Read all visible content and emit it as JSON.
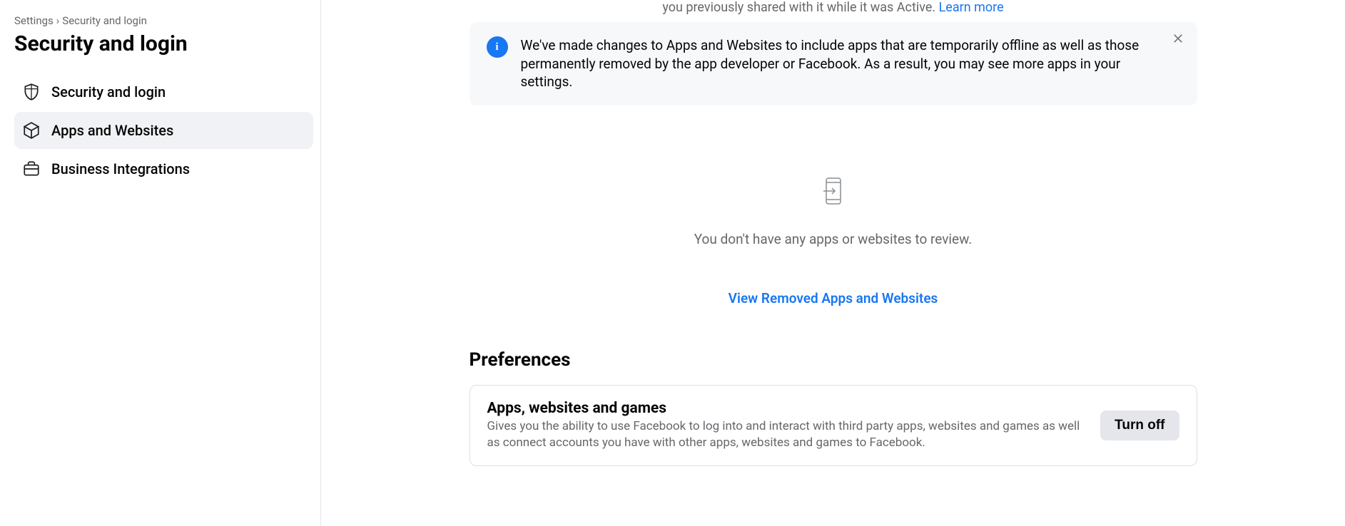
{
  "breadcrumb": {
    "root": "Settings",
    "sep": "›",
    "current": "Security and login"
  },
  "page_title": "Security and login",
  "sidebar": {
    "items": [
      {
        "label": "Security and login"
      },
      {
        "label": "Apps and Websites"
      },
      {
        "label": "Business Integrations"
      }
    ]
  },
  "cutoff": {
    "text_partial": "you previously shared with it while it was Active. ",
    "link": "Learn more"
  },
  "info_banner": {
    "icon_glyph": "i",
    "text": "We've made changes to Apps and Websites to include apps that are temporarily offline as well as those permanently removed by the app developer or Facebook. As a result, you may see more apps in your settings."
  },
  "empty_state": {
    "text": "You don't have any apps or websites to review."
  },
  "view_removed_link": "View Removed Apps and Websites",
  "preferences": {
    "heading": "Preferences",
    "card": {
      "title": "Apps, websites and games",
      "desc": "Gives you the ability to use Facebook to log into and interact with third party apps, websites and games as well as connect accounts you have with other apps, websites and games to Facebook.",
      "button": "Turn off"
    }
  }
}
